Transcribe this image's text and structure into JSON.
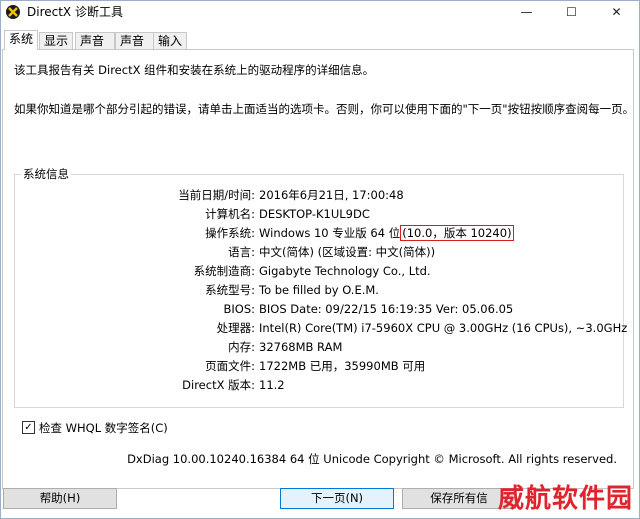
{
  "window": {
    "title": "DirectX 诊断工具",
    "minimize": "—",
    "maximize": "☐",
    "close": "✕"
  },
  "tabs": [
    "系统",
    "显示",
    "声音 1",
    "声音 2",
    "输入"
  ],
  "intro": {
    "line1": "该工具报告有关 DirectX 组件和安装在系统上的驱动程序的详细信息。",
    "line2": "如果你知道是哪个部分引起的错误，请单击上面适当的选项卡。否则，你可以使用下面的\"下一页\"按钮按顺序查阅每一页。"
  },
  "sysinfo": {
    "group_title": "系统信息",
    "rows": [
      {
        "label": "当前日期/时间:",
        "value": "2016年6月21日, 17:00:48"
      },
      {
        "label": "计算机名:",
        "value": "DESKTOP-K1UL9DC"
      },
      {
        "label": "操作系统:",
        "value": "Windows 10 专业版 64 位",
        "highlight": "(10.0，版本 10240)"
      },
      {
        "label": "语言:",
        "value": "中文(简体) (区域设置: 中文(简体))"
      },
      {
        "label": "系统制造商:",
        "value": "Gigabyte Technology Co., Ltd."
      },
      {
        "label": "系统型号:",
        "value": "To be filled by O.E.M."
      },
      {
        "label": "BIOS:",
        "value": "BIOS Date: 09/22/15 16:19:35 Ver: 05.06.05"
      },
      {
        "label": "处理器:",
        "value": "Intel(R) Core(TM) i7-5960X CPU @ 3.00GHz (16 CPUs), ~3.0GHz"
      },
      {
        "label": "内存:",
        "value": "32768MB RAM"
      },
      {
        "label": "页面文件:",
        "value": "1722MB 已用，35990MB 可用"
      },
      {
        "label": "DirectX 版本:",
        "value": "11.2"
      }
    ]
  },
  "whql": {
    "label": "检查 WHQL 数字签名(C)",
    "checked": true
  },
  "footer": "DxDiag 10.00.10240.16384 64 位 Unicode  Copyright © Microsoft. All rights reserved.",
  "buttons": {
    "help": "帮助(H)",
    "next": "下一页(N)",
    "save": "保存所有信"
  },
  "watermark": "威航软件园",
  "colors": {
    "highlight_border": "#d0201f",
    "primary_button": "#0078d7",
    "watermark": "#e0242d"
  }
}
